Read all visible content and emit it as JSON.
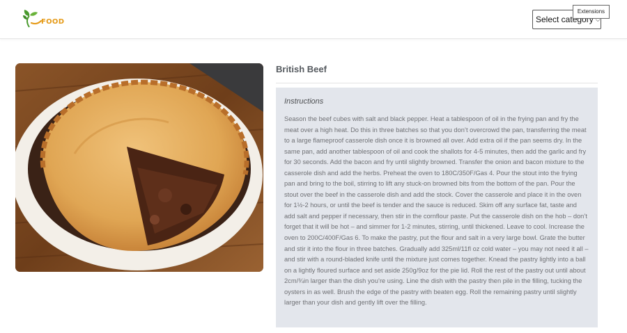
{
  "header": {
    "logo_text": "FOOD",
    "category_select": {
      "selected": "Select category"
    },
    "extensions_tooltip": "Extensions"
  },
  "recipe": {
    "title": "British Beef",
    "image_alt": "beef and oyster pie with a slice removed",
    "instructions_heading": "Instructions",
    "instructions": "Season the beef cubes with salt and black pepper. Heat a tablespoon of oil in the frying pan and fry the meat over a high heat. Do this in three batches so that you don’t overcrowd the pan, transferring the meat to a large flameproof casserole dish once it is browned all over. Add extra oil if the pan seems dry. In the same pan, add another tablespoon of oil and cook the shallots for 4-5 minutes, then add the garlic and fry for 30 seconds. Add the bacon and fry until slightly browned. Transfer the onion and bacon mixture to the casserole dish and add the herbs. Preheat the oven to 180C/350F/Gas 4. Pour the stout into the frying pan and bring to the boil, stirring to lift any stuck-on browned bits from the bottom of the pan. Pour the stout over the beef in the casserole dish and add the stock. Cover the casserole and place it in the oven for 1½-2 hours, or until the beef is tender and the sauce is reduced. Skim off any surface fat, taste and add salt and pepper if necessary, then stir in the cornflour paste. Put the casserole dish on the hob – don’t forget that it will be hot – and simmer for 1-2 minutes, stirring, until thickened. Leave to cool. Increase the oven to 200C/400F/Gas 6. To make the pastry, put the flour and salt in a very large bowl. Grate the butter and stir it into the flour in three batches. Gradually add 325ml/11fl oz cold water – you may not need it all – and stir with a round-bladed knife until the mixture just comes together. Knead the pastry lightly into a ball on a lightly floured surface and set aside 250g/9oz for the pie lid. Roll the rest of the pastry out until about 2cm/¾in larger than the dish you’re using. Line the dish with the pastry then pile in the filling, tucking the oysters in as well. Brush the edge of the pastry with beaten egg. Roll the remaining pastry until slightly larger than your dish and gently lift over the filling."
  },
  "colors": {
    "accent": "#e59a17",
    "leaf": "#4a9a2e",
    "panel_bg": "#e3e6ec"
  }
}
